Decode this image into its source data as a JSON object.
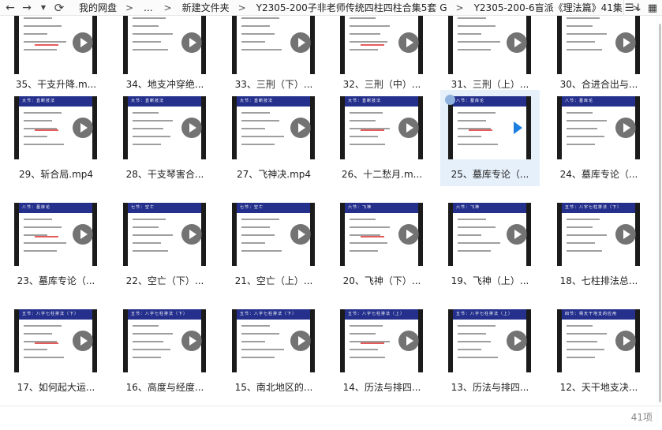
{
  "toolbar": {
    "back_icon": "arrow-left-icon",
    "forward_icon": "arrow-right-icon",
    "history_icon": "chevron-down-icon",
    "refresh_icon": "refresh-icon",
    "breadcrumb": [
      "我的网盘",
      "...",
      "新建文件夹",
      "Y2305-200子非老师传统四柱四柱合集5套 G",
      "Y2305-200-6盲派《理法篇》41集"
    ],
    "breadcrumb_more": ">",
    "sort_icon": "sort-icon",
    "view_icon": "grid-view-icon"
  },
  "files": [
    {
      "name": "35、干支升降.m...",
      "selected": false
    },
    {
      "name": "34、地支冲穿绝...",
      "selected": false
    },
    {
      "name": "33、三刑（下）...",
      "selected": false
    },
    {
      "name": "32、三刑（中）...",
      "selected": false
    },
    {
      "name": "31、三刑（上）...",
      "selected": false
    },
    {
      "name": "30、合进合出与...",
      "selected": false
    },
    {
      "name": "29、斩合局.mp4",
      "selected": false,
      "slide_title": "大节：直断技法"
    },
    {
      "name": "28、干支琴害合...",
      "selected": false,
      "slide_title": "大节：直断技法"
    },
    {
      "name": "27、飞神决.mp4",
      "selected": false,
      "slide_title": "大节：直断技法"
    },
    {
      "name": "26、十二愁月.m...",
      "selected": false,
      "slide_title": "大节：直断技法"
    },
    {
      "name": "25、墓库专论（...",
      "selected": true,
      "slide_title": "八节：墓库论"
    },
    {
      "name": "24、墓库专论（...",
      "selected": false,
      "slide_title": "八节：墓库论"
    },
    {
      "name": "23、墓库专论（...",
      "selected": false,
      "slide_title": "八节：墓库论"
    },
    {
      "name": "22、空亡（下）...",
      "selected": false,
      "slide_title": "七节：空亡"
    },
    {
      "name": "21、空亡（上）...",
      "selected": false,
      "slide_title": "七节：空亡"
    },
    {
      "name": "20、飞神（下）...",
      "selected": false,
      "slide_title": "六节：飞神"
    },
    {
      "name": "19、飞神（上）...",
      "selected": false,
      "slide_title": "六节：飞神"
    },
    {
      "name": "18、七柱排法总...",
      "selected": false,
      "slide_title": "五节：八字七柱排法（下）"
    },
    {
      "name": "17、如何起大运...",
      "selected": false,
      "slide_title": "五节：八字七柱排法（下）"
    },
    {
      "name": "16、高度与经度...",
      "selected": false,
      "slide_title": "五节：八字七柱排法（下）"
    },
    {
      "name": "15、南北地区的...",
      "selected": false,
      "slide_title": "五节：八字七柱排法（下）"
    },
    {
      "name": "14、历法与排四...",
      "selected": false,
      "slide_title": "五节：八字七柱排法（上）"
    },
    {
      "name": "13、历法与排四...",
      "selected": false,
      "slide_title": "五节：八字七柱排法（上）"
    },
    {
      "name": "12、天干地支决...",
      "selected": false,
      "slide_title": "四节：柄天干地支的应用"
    }
  ],
  "status": {
    "item_count": "41项"
  },
  "colors": {
    "slide_header": "#25308d",
    "selected_tile": "#e6f0fb",
    "play_selected": "#1a7fe0"
  }
}
